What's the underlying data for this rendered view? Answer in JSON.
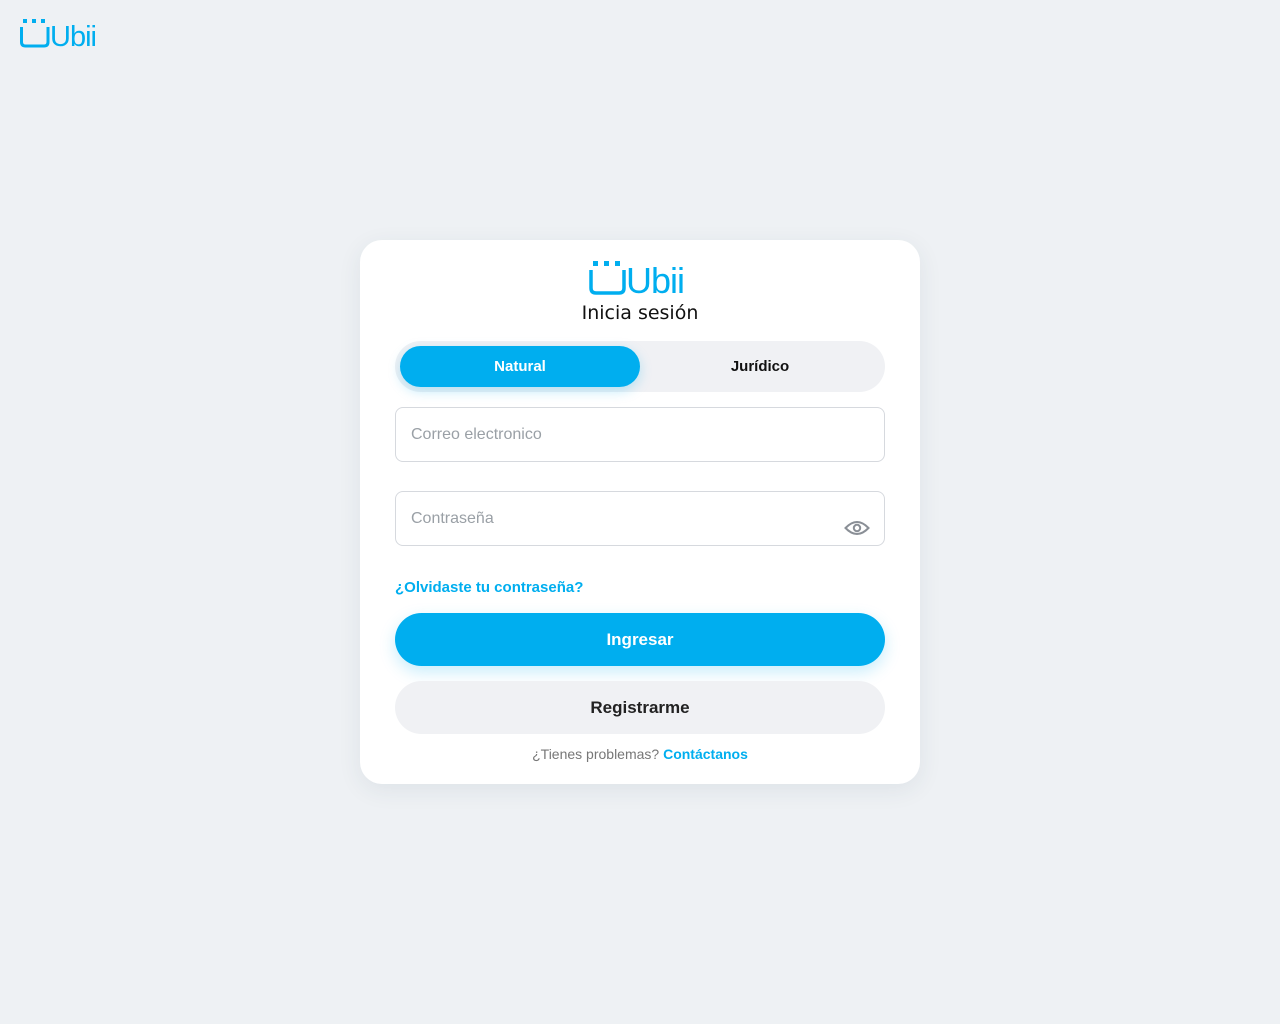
{
  "brand": {
    "name": "Ubii",
    "color": "#00aeef"
  },
  "login": {
    "title": "Inicia sesión",
    "account_types": [
      {
        "label": "Natural",
        "selected": true
      },
      {
        "label": "Jurídico",
        "selected": false
      }
    ],
    "email": {
      "placeholder": "Correo electronico",
      "value": ""
    },
    "password": {
      "placeholder": "Contraseña",
      "value": "",
      "toggle_icon": "eye-icon"
    },
    "forgot_link": "¿Olvidaste tu contraseña?",
    "submit_label": "Ingresar",
    "register_label": "Registrarme",
    "help_text": "¿Tienes problemas?",
    "help_link": "Contáctanos"
  }
}
